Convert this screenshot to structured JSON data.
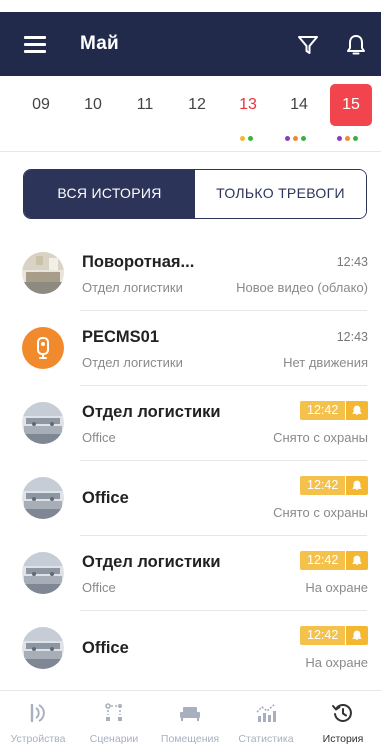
{
  "header": {
    "title": "Май"
  },
  "dates": [
    {
      "day": "09",
      "dots": []
    },
    {
      "day": "10",
      "dots": []
    },
    {
      "day": "11",
      "dots": []
    },
    {
      "day": "12",
      "dots": []
    },
    {
      "day": "13",
      "dots": [
        "#f4b732",
        "#3cb043"
      ]
    },
    {
      "day": "14",
      "dots": [
        "#8a3fb8",
        "#f18a2c",
        "#3cb043"
      ]
    },
    {
      "day": "15",
      "dots": [
        "#8a3fb8",
        "#f18a2c",
        "#3cb043"
      ]
    }
  ],
  "tabs": {
    "all": "ВСЯ ИСТОРИЯ",
    "alarms": "ТОЛЬКО ТРЕВОГИ"
  },
  "events": [
    {
      "title": "Поворотная...",
      "subtitle": "Отдел логистики",
      "time": "12:43",
      "status": "Новое видео (облако)"
    },
    {
      "title": "PECMS01",
      "subtitle": "Отдел логистики",
      "time": "12:43",
      "status": "Нет движения"
    },
    {
      "title": "Отдел логистики",
      "subtitle": "Office",
      "time": "12:42",
      "status": "Снято с охраны"
    },
    {
      "title": "Office",
      "subtitle": "",
      "time": "12:42",
      "status": "Снято с охраны"
    },
    {
      "title": "Отдел логистики",
      "subtitle": "Office",
      "time": "12:42",
      "status": "На охране"
    },
    {
      "title": "Office",
      "subtitle": "",
      "time": "12:42",
      "status": "На охране"
    }
  ],
  "nav": {
    "devices": "Устройства",
    "scenarios": "Сценарии",
    "rooms": "Помещения",
    "stats": "Статистика",
    "history": "История"
  },
  "colors": {
    "header_bg": "#222a4c",
    "accent_red": "#f1444c",
    "alarm_yellow": "#f4c24c",
    "segment": "#2c3559"
  }
}
